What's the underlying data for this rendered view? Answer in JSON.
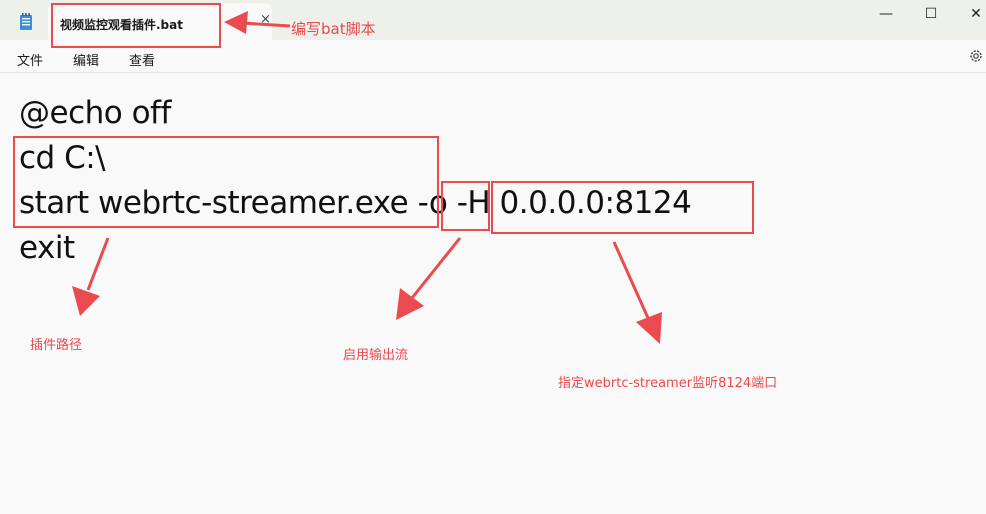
{
  "window": {
    "tab_title": "视频监控观看插件.bat",
    "close_tab_glyph": "×",
    "minimize_glyph": "—",
    "maximize_glyph": "☐",
    "close_glyph": "✕"
  },
  "menu": {
    "items": [
      "文件",
      "编辑",
      "查看"
    ]
  },
  "editor": {
    "lines": [
      "@echo off",
      "cd C:\\",
      "start webrtc-streamer.exe -o -H 0.0.0.0:8124",
      "exit"
    ],
    "line3_parts": [
      "start webrtc-streamer.exe",
      "-o",
      "-H 0.0.0.0:8124"
    ]
  },
  "annotations": {
    "write_bat": "编写bat脚本",
    "plugin_path": "插件路径",
    "enable_output": "启用输出流",
    "listen_port": "指定webrtc-streamer监听8124端口",
    "color": "#e94b4e"
  },
  "icons": [
    "notepad-icon",
    "gear-icon",
    "close-icon",
    "minimize-icon",
    "maximize-icon"
  ]
}
